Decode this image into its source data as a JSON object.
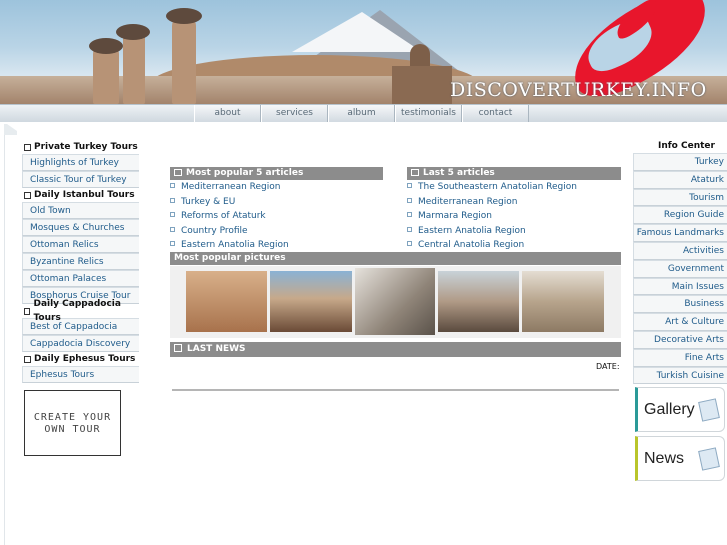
{
  "header": {
    "logo_text": "DISCOVERTURKEY.INFO",
    "nav_tabs": [
      "about",
      "services",
      "album",
      "testimonials",
      "contact"
    ]
  },
  "left_sidebar": {
    "groups": [
      {
        "title": "Private Turkey Tours",
        "items": [
          "Highlights of Turkey",
          "Classic Tour of Turkey"
        ]
      },
      {
        "title": "Daily Istanbul Tours",
        "items": [
          "Old Town",
          "Mosques & Churches",
          "Ottoman Relics",
          "Byzantine Relics",
          "Ottoman Palaces",
          "Bosphorus Cruise Tour"
        ]
      },
      {
        "title": "Daily Cappadocia Tours",
        "items": [
          "Best of Cappadocia",
          "Cappadocia Discovery"
        ]
      },
      {
        "title": "Daily Ephesus Tours",
        "items": [
          "Ephesus Tours"
        ]
      }
    ],
    "create_tour": {
      "line1": "CREATE YOUR",
      "line2": "OWN TOUR"
    }
  },
  "main": {
    "popular_articles": {
      "title": "Most popular 5 articles",
      "items": [
        "Mediterranean Region",
        "Turkey & EU",
        "Reforms of Ataturk",
        "Country Profile",
        "Eastern Anatolia Region"
      ]
    },
    "last_articles": {
      "title": "Last 5 articles",
      "items": [
        "The Southeastern Anatolian Region",
        "Mediterranean Region",
        "Marmara Region",
        "Eastern Anatolia Region",
        "Central Anatolia Region"
      ]
    },
    "popular_pictures_title": "Most popular pictures",
    "last_news_title": "LAST NEWS",
    "date_label": "DATE:"
  },
  "right_sidebar": {
    "title": "Info Center",
    "items": [
      "Turkey",
      "Ataturk",
      "Tourism",
      "Region Guide",
      "Famous Landmarks",
      "Activities",
      "Government",
      "Main Issues",
      "Business",
      "Art & Culture",
      "Decorative Arts",
      "Fine Arts",
      "Turkish Cuisine"
    ],
    "promos": [
      "Gallery",
      "News"
    ]
  },
  "colors": {
    "link": "#1f5b8a",
    "section_header": "#8c8c8c",
    "logo_flame": "#e8162c"
  }
}
